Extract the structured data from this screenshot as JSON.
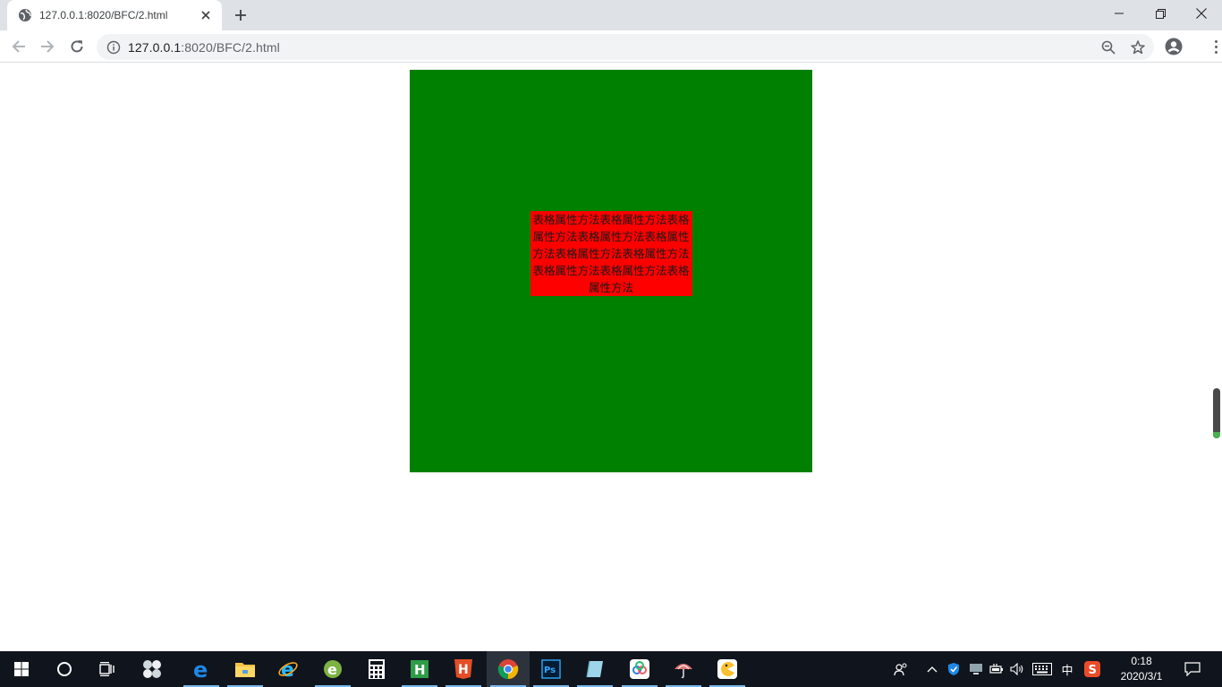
{
  "browser": {
    "tab_title": "127.0.0.1:8020/BFC/2.html",
    "url_host": "127.0.0.1",
    "url_rest": ":8020/BFC/2.html"
  },
  "page": {
    "box_color": "#008000",
    "cell_color": "#ff0000",
    "cell_text": "表格属性方法表格属性方法表格属性方法表格属性方法表格属性方法表格属性方法表格属性方法表格属性方法表格属性方法表格属性方法"
  },
  "taskbar": {
    "apps": [
      "start-icon",
      "cortana-icon",
      "task-view-icon",
      "pinwheel-app-icon",
      "edge-icon",
      "file-explorer-icon",
      "internet-explorer-icon",
      "ie-green-icon",
      "calculator-icon",
      "hbuilder-icon",
      "html5-editor-icon",
      "chrome-icon",
      "photoshop-icon",
      "notes-icon",
      "baidu-cloud-icon",
      "umbrella-app-icon",
      "pacman-game-icon"
    ],
    "ime_label": "中",
    "clock_time": "0:18",
    "clock_date": "2020/3/1"
  }
}
